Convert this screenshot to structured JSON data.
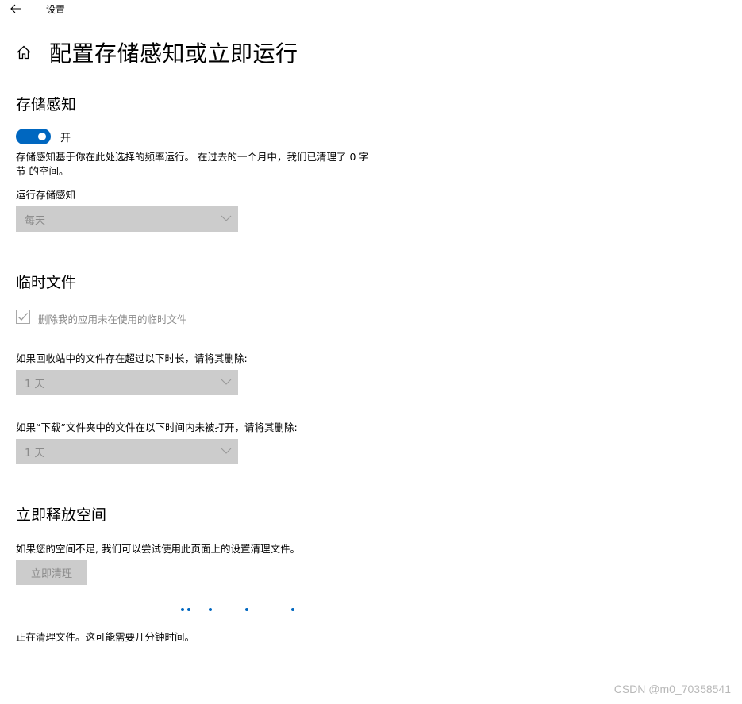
{
  "window": {
    "title": "设置"
  },
  "header": {
    "title": "配置存储感知或立即运行"
  },
  "storage_sense": {
    "heading": "存储感知",
    "toggle_state": "开",
    "toggle_on": true,
    "description": "存储感知基于你在此处选择的频率运行。 在过去的一个月中，我们已清理了 0 字节 的空间。",
    "run_label": "运行存储感知",
    "run_value": "每天"
  },
  "temp_files": {
    "heading": "临时文件",
    "checkbox_label": "删除我的应用未在使用的临时文件",
    "checkbox_checked": true,
    "recycle_label": "如果回收站中的文件存在超过以下时长，请将其删除:",
    "recycle_value": "1 天",
    "downloads_label": "如果“下载”文件夹中的文件在以下时间内未被打开，请将其删除:",
    "downloads_value": "1 天"
  },
  "free_space": {
    "heading": "立即释放空间",
    "description": "如果您的空间不足, 我们可以尝试使用此页面上的设置清理文件。",
    "button_label": "立即清理",
    "status": "正在清理文件。这可能需要几分钟时间。"
  },
  "watermark": "CSDN @m0_70358541",
  "colors": {
    "accent": "#0067c0",
    "disabled_bg": "#cccccc",
    "disabled_text": "#8a8a8a"
  }
}
